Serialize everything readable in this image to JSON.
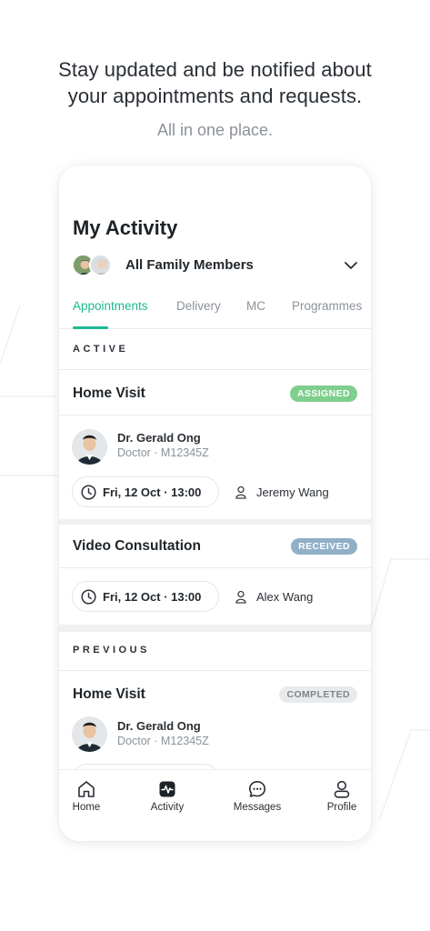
{
  "headline": {
    "line1": "Stay updated and be notified about",
    "line2": "your appointments and requests.",
    "subline": "All in one place."
  },
  "screen": {
    "title": "My Activity",
    "family_selector": {
      "label": "All Family Members",
      "icon": "chevron-down-icon"
    },
    "tabs": [
      {
        "label": "Appointments",
        "active": true
      },
      {
        "label": "Delivery",
        "active": false
      },
      {
        "label": "MC",
        "active": false
      },
      {
        "label": "Programmes",
        "active": false
      }
    ],
    "sections": {
      "active_label": "ACTIVE",
      "previous_label": "PREVIOUS"
    },
    "cards": [
      {
        "title": "Home Visit",
        "status": "ASSIGNED",
        "doctor_name": "Dr. Gerald Ong",
        "doctor_meta": "Doctor  ·  M12345Z",
        "datetime": "Fri, 12 Oct   ·  13:00",
        "patient": "Jeremy Wang"
      },
      {
        "title": "Video Consultation",
        "status": "RECEIVED",
        "datetime": "Fri, 12 Oct   ·  13:00",
        "patient": "Alex Wang"
      },
      {
        "title": "Home Visit",
        "status": "COMPLETED",
        "doctor_name": "Dr. Gerald Ong",
        "doctor_meta": "Doctor  ·  M12345Z"
      }
    ],
    "bottom_nav": [
      {
        "label": "Home",
        "icon": "home-icon"
      },
      {
        "label": "Activity",
        "icon": "activity-icon"
      },
      {
        "label": "Messages",
        "icon": "messages-icon"
      },
      {
        "label": "Profile",
        "icon": "profile-icon"
      }
    ]
  },
  "colors": {
    "accent": "#1cb893",
    "assigned": "#7ecf8e",
    "received": "#8fb0c6",
    "completed_bg": "#e8eaec"
  }
}
